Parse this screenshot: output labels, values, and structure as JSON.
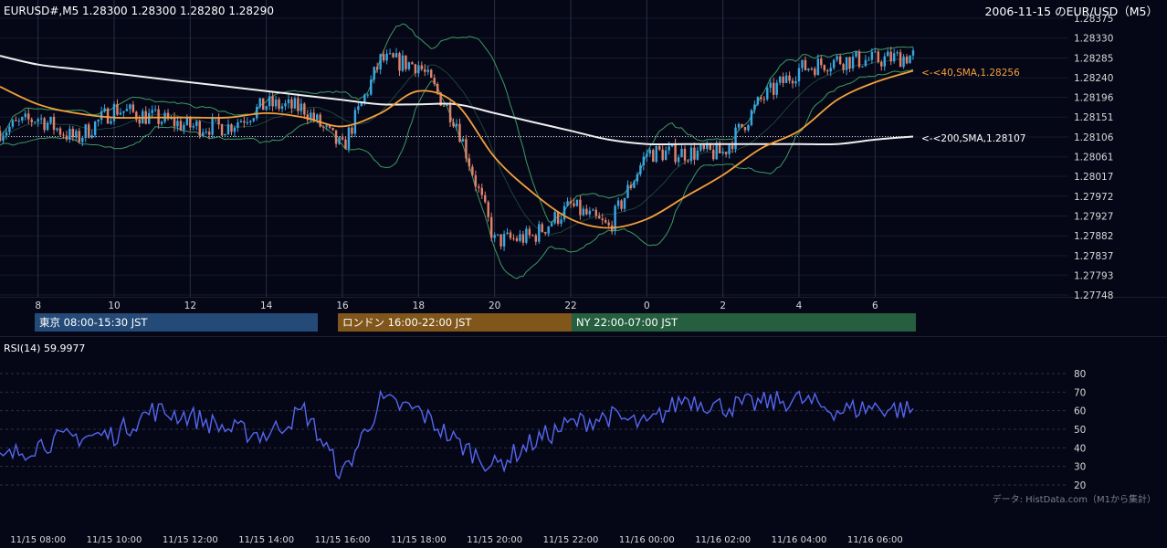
{
  "header": {
    "symbol_info": "EURUSD#,M5 1.28300 1.28300 1.28280 1.28290",
    "date_title": "2006-11-15 のEUR/USD（M5）"
  },
  "price_axis": {
    "labels": [
      "1.28375",
      "1.28330",
      "1.28285",
      "1.28240",
      "1.28196",
      "1.28151",
      "1.28106",
      "1.28061",
      "1.28017",
      "1.27972",
      "1.27927",
      "1.27882",
      "1.27837",
      "1.27793",
      "1.27748"
    ]
  },
  "top_time_axis": {
    "labels": [
      "8",
      "10",
      "12",
      "14",
      "16",
      "18",
      "20",
      "22",
      "0",
      "2",
      "4",
      "6"
    ]
  },
  "sessions": [
    {
      "label": "東京 08:00-15:30 JST",
      "color": "#244a78"
    },
    {
      "label": "ロンドン 16:00-22:00 JST",
      "color": "#80561a"
    },
    {
      "label": "NY 22:00-07:00 JST",
      "color": "#255f3f"
    }
  ],
  "indicators": {
    "sma40_label": "<-<40,SMA,1.28256",
    "sma200_label": "<-<200,SMA,1.28107",
    "sma40_color": "#f5a03a",
    "sma200_color": "#eeeeee",
    "bollinger_color": "#3d9a63",
    "bull_color": "#3aa6e0",
    "bear_color": "#e0826a"
  },
  "rsi": {
    "title": "RSI(14) 59.9977",
    "axis_labels": [
      "80",
      "70",
      "60",
      "50",
      "40",
      "30",
      "20"
    ],
    "line_color": "#5566ee"
  },
  "bottom_time_axis": {
    "labels": [
      "11/15 08:00",
      "11/15 10:00",
      "11/15 12:00",
      "11/15 14:00",
      "11/15 16:00",
      "11/15 18:00",
      "11/15 20:00",
      "11/15 22:00",
      "11/16 00:00",
      "11/16 02:00",
      "11/16 04:00",
      "11/16 06:00"
    ]
  },
  "source_note": "データ: HistData.com（M1から集計）",
  "chart_data": {
    "type": "line",
    "price_ylim": [
      1.27748,
      1.28375
    ],
    "rsi_ylim": [
      20,
      80
    ],
    "x": [
      "11/15 07:00",
      "11/15 08:00",
      "11/15 09:00",
      "11/15 10:00",
      "11/15 11:00",
      "11/15 12:00",
      "11/15 13:00",
      "11/15 14:00",
      "11/15 15:00",
      "11/15 16:00",
      "11/15 17:00",
      "11/15 18:00",
      "11/15 19:00",
      "11/15 20:00",
      "11/15 21:00",
      "11/15 22:00",
      "11/15 23:00",
      "11/16 00:00",
      "11/16 01:00",
      "11/16 02:00",
      "11/16 03:00",
      "11/16 04:00",
      "11/16 05:00",
      "11/16 06:00",
      "11/16 06:55"
    ],
    "series": [
      {
        "name": "40,SMA",
        "values": [
          1.2822,
          1.2818,
          1.2816,
          1.2815,
          1.2815,
          1.2815,
          1.2815,
          1.2816,
          1.2815,
          1.2813,
          1.2816,
          1.2821,
          1.2818,
          1.2806,
          1.2798,
          1.2792,
          1.279,
          1.2792,
          1.2797,
          1.2802,
          1.2808,
          1.2812,
          1.2819,
          1.2823,
          1.28256
        ]
      },
      {
        "name": "200,SMA",
        "values": [
          1.2829,
          1.2827,
          1.2826,
          1.2825,
          1.2824,
          1.2823,
          1.2822,
          1.2821,
          1.282,
          1.2819,
          1.2818,
          1.2818,
          1.2818,
          1.2816,
          1.2814,
          1.2812,
          1.281,
          1.2809,
          1.2809,
          1.2809,
          1.2809,
          1.2809,
          1.2809,
          1.281,
          1.28107
        ]
      },
      {
        "name": "close",
        "values": [
          1.2812,
          1.2815,
          1.281,
          1.2817,
          1.2815,
          1.2813,
          1.2813,
          1.2818,
          1.2817,
          1.2808,
          1.2828,
          1.2827,
          1.2814,
          1.2787,
          1.2788,
          1.2795,
          1.279,
          1.2807,
          1.2807,
          1.2807,
          1.2819,
          1.2826,
          1.2828,
          1.2828,
          1.2829
        ]
      },
      {
        "name": "RSI(14)",
        "values": [
          33,
          42,
          46,
          47,
          60,
          57,
          50,
          47,
          60,
          25,
          65,
          60,
          43,
          30,
          43,
          53,
          57,
          52,
          67,
          62,
          64,
          66,
          60,
          62,
          60
        ]
      }
    ]
  }
}
